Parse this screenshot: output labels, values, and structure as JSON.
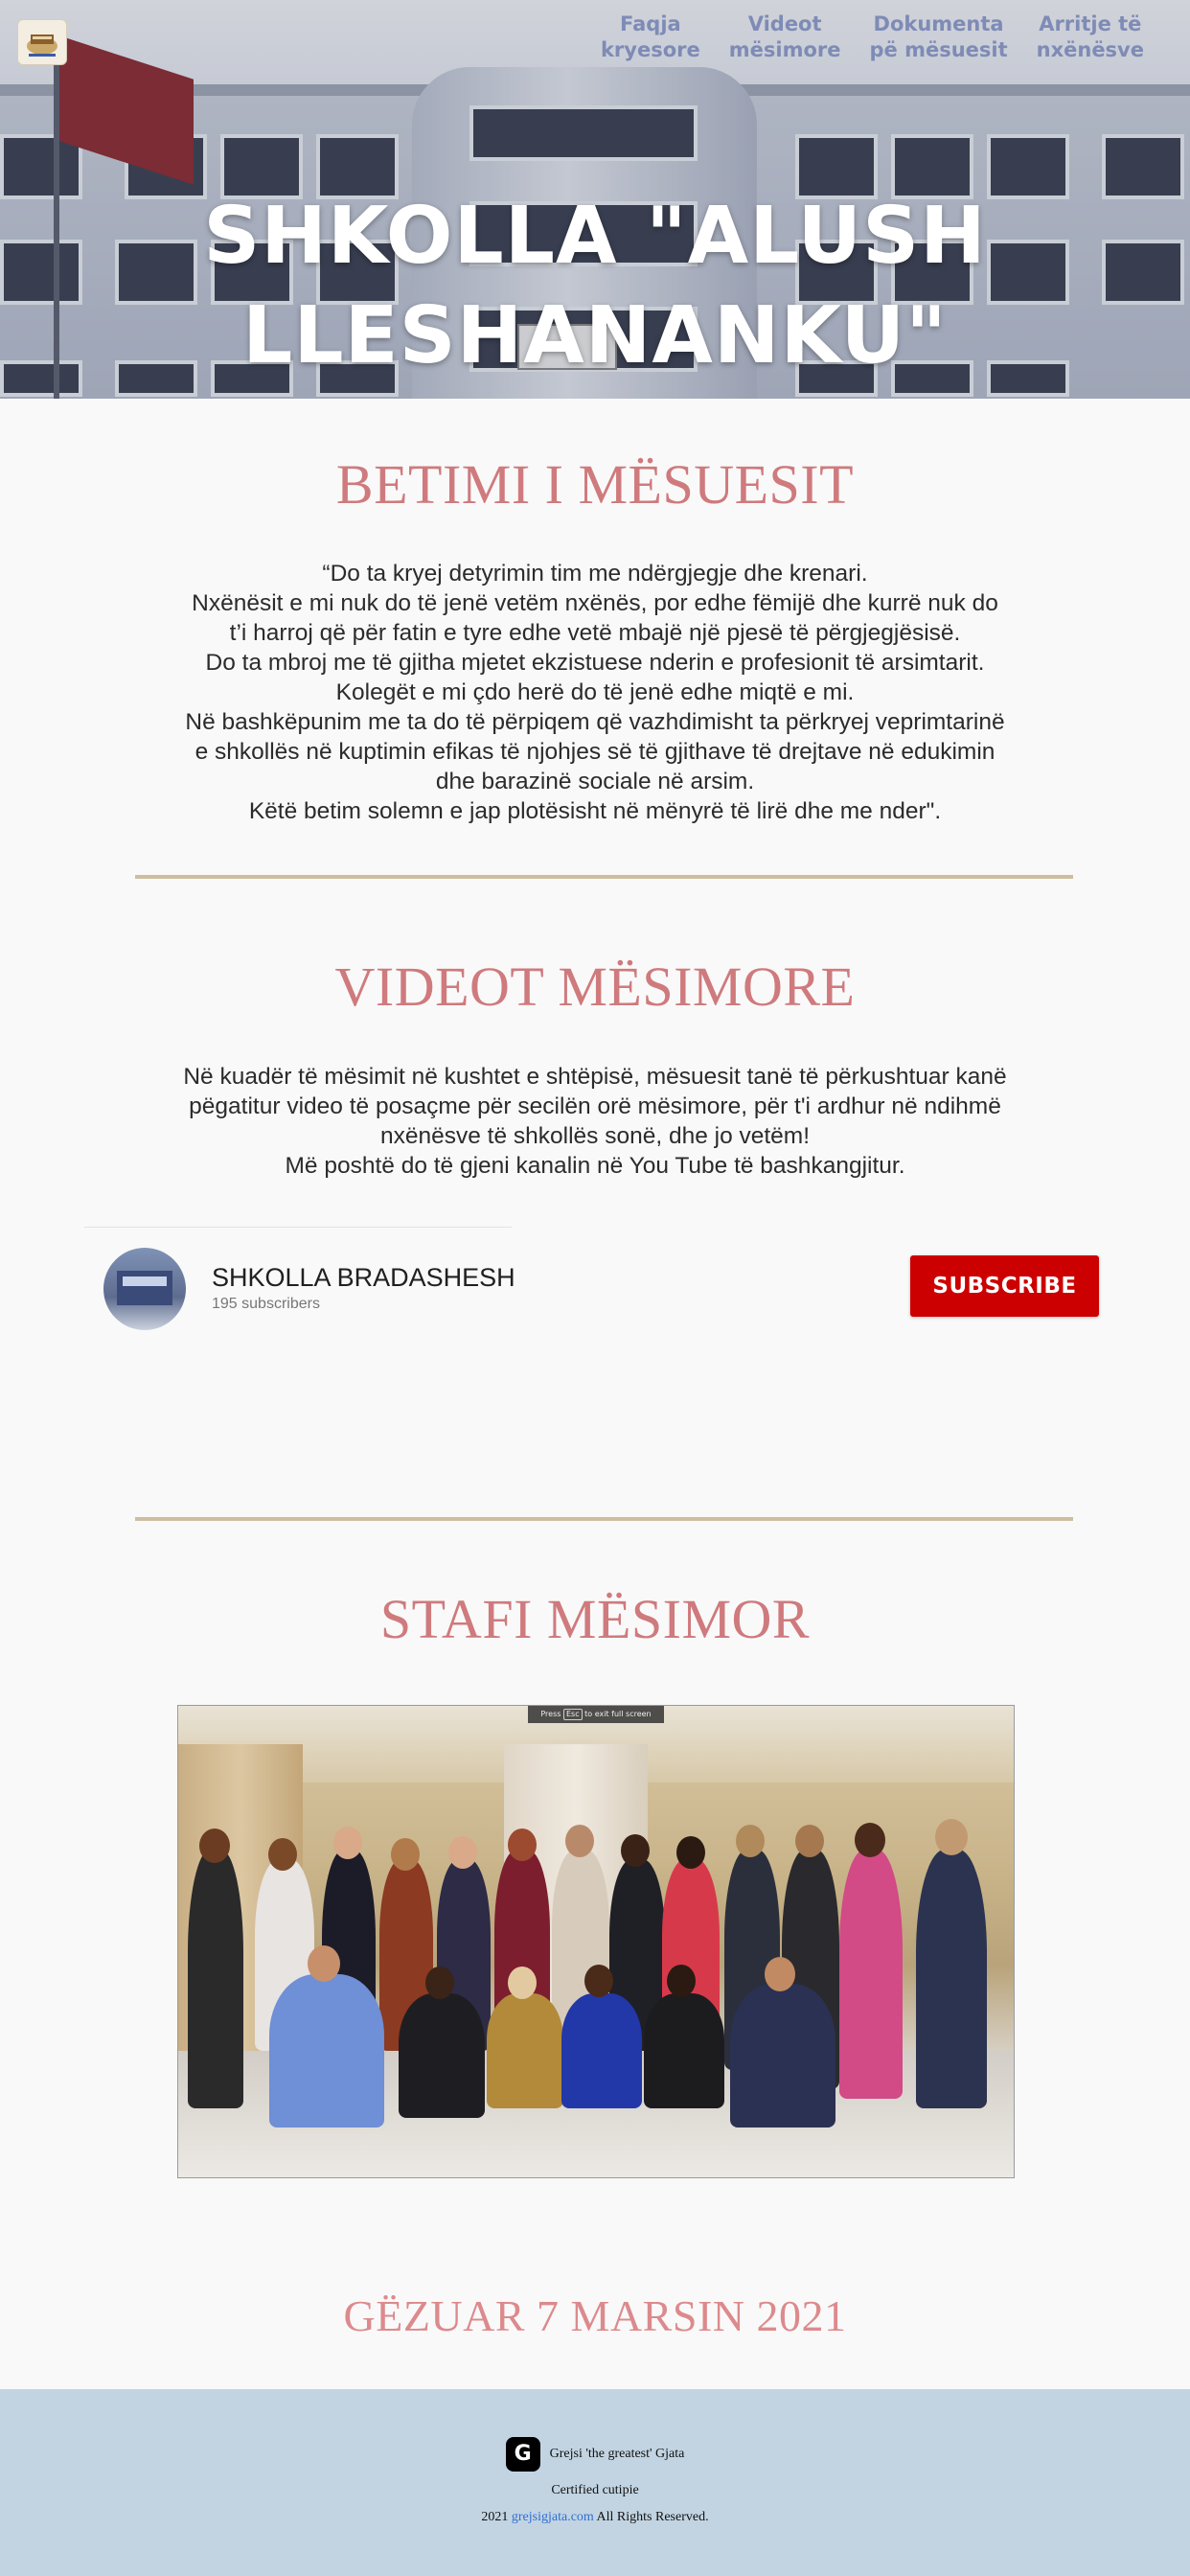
{
  "logo": {
    "alt_text": "Shkolla logo"
  },
  "nav": {
    "items": [
      {
        "line1": "Faqja",
        "line2": "kryesore"
      },
      {
        "line1": "Videot",
        "line2": "mësimore"
      },
      {
        "line1": "Dokumenta",
        "line2": "pë mësuesit"
      },
      {
        "line1": "Arritje të",
        "line2": "nxënësve"
      }
    ]
  },
  "hero": {
    "title_line1": "SHKOLLA \"ALUSH",
    "title_line2": "LLESHANANKU\""
  },
  "oath": {
    "title": "BETIMI I MËSUESIT",
    "lines": [
      "“Do ta kryej detyrimin tim me ndërgjegje dhe krenari.",
      "Nxënësit e mi nuk do të jenë vetëm nxënës, por edhe fëmijë dhe kurrë nuk do",
      "t’i harroj që për fatin e tyre edhe vetë mbajë një pjesë të përgjegjësisë.",
      "Do ta mbroj me të gjitha mjetet ekzistuese nderin e profesionit të arsimtarit.",
      "Kolegët e mi çdo herë do të jenë edhe miqtë e mi.",
      "Në bashkëpunim me ta do të përpiqem që vazhdimisht ta përkryej veprimtarinë",
      "e shkollës në kuptimin efikas të njohjes së të gjithave të drejtave në edukimin",
      "dhe barazinë sociale në arsim.",
      "Këtë betim solemn e jap plotësisht në mënyrë të lirë dhe me nder\"."
    ]
  },
  "videos": {
    "title": "VIDEOT MËSIMORE",
    "lines": [
      "Në kuadër të mësimit në kushtet e shtëpisë, mësuesit tanë të përkushtuar kanë",
      "pëgatitur video të posaçme për secilën orë mësimore, për t'i ardhur në ndihmë",
      "nxënësve të shkollës sonë, dhe jo vetëm!",
      "Më poshtë do të gjeni kanalin në You Tube të bashkangjitur."
    ],
    "channel": {
      "name": "SHKOLLA BRADASHESH",
      "subscribers": "195 subscribers",
      "subscribe_label": "SUBSCRIBE"
    }
  },
  "staff": {
    "title": "STAFI MËSIMOR",
    "photo_caption_pre": "Press",
    "photo_caption_key": "Esc",
    "photo_caption_post": "to exit full screen"
  },
  "greeting": {
    "title": "GËZUAR 7 MARSIN 2021"
  },
  "footer": {
    "logo_letter": "G",
    "brand": "Grejsi 'the greatest' Gjata",
    "certified": "Certified cutipie",
    "copyright_pre": "2021",
    "link": "grejsigjata.com",
    "copyright_post": "All Rights Reserved."
  },
  "colors": {
    "section_title": "#cf7a7d",
    "nav_text": "#7e8bb6",
    "divider": "#cdbea0",
    "subscribe_bg": "#cc0000",
    "footer_bg": "#c2d4e2",
    "link": "#2f6fd6"
  }
}
